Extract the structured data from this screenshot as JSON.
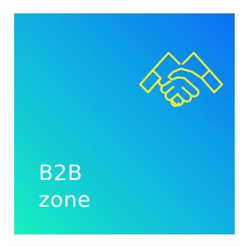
{
  "tile": {
    "line1": "B2B",
    "line2": "zone",
    "icon": "handshake-icon",
    "icon_color": "#f2ee3c",
    "gradient_colors": [
      "#17f0bf",
      "#11c3d9",
      "#0d9fe6",
      "#0b6ff2"
    ],
    "text_color": "#ffffff"
  }
}
